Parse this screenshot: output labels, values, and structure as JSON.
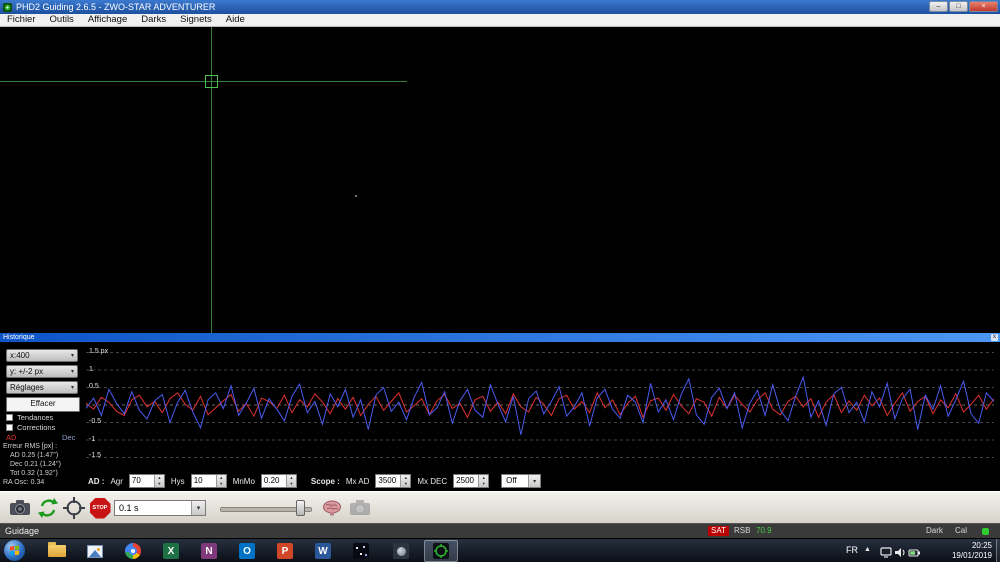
{
  "window": {
    "title": "PHD2 Guiding 2.6.5 - ZWO-STAR ADVENTURER"
  },
  "icons": {
    "minimize": "–",
    "maximize": "□",
    "close": "×",
    "close_small": "x",
    "dropdown": "▾",
    "spin_up": "▲",
    "spin_down": "▼",
    "tray_expand": "▲"
  },
  "menu": {
    "items": [
      "Fichier",
      "Outils",
      "Affichage",
      "Darks",
      "Signets",
      "Aide"
    ]
  },
  "history": {
    "title": "Historique",
    "controls": {
      "scale_x": "x:400",
      "scale_y": "y: +/-2 px",
      "settings": "Réglages",
      "clear": "Effacer",
      "trend_label": "Tendances",
      "corrections_label": "Corrections",
      "legend_ra": "AD",
      "legend_dec": "Dec"
    },
    "stats": {
      "header": "Erreur RMS [px] :",
      "ra": "AD 0.25 (1.47'')",
      "dec": "Dec 0.21 (1.24'')",
      "tot": "Tot 0.32 (1.92'')",
      "osc": "RA Osc: 0.34"
    },
    "params": {
      "ra_label": "AD :",
      "agr_label": "Agr",
      "agr_value": "70",
      "hys_label": "Hys",
      "hys_value": "10",
      "mnmo_label": "MnMo",
      "mnmo_value": "0.20",
      "scope_label": "Scope :",
      "mxad_label": "Mx AD",
      "mxad_value": "3500",
      "mxdec_label": "Mx DEC",
      "mxdec_value": "2500",
      "dec_mode_value": "Off"
    }
  },
  "chart_data": {
    "type": "line",
    "title": "",
    "xlabel": "",
    "ylabel": "px",
    "ylim": [
      -1.5,
      1.5
    ],
    "grid": true,
    "ytick_values": [
      1.5,
      1,
      0.5,
      0,
      -0.5,
      -1,
      -1.5
    ],
    "ytick_labels": [
      "1.5 px",
      "1",
      "0.5",
      "-0.5",
      "-1",
      "-1.5"
    ],
    "legend_position": "left-panel",
    "series": [
      {
        "name": "AD",
        "color": "#e03232",
        "values": [
          0.05,
          -0.12,
          0.22,
          0.08,
          -0.18,
          -0.3,
          0.15,
          0.28,
          -0.05,
          0.1,
          -0.22,
          0.18,
          0.35,
          0.02,
          -0.15,
          0.25,
          -0.28,
          -0.08,
          0.12,
          0.3,
          -0.18,
          0.05,
          -0.32,
          0.2,
          0.1,
          -0.1,
          0.28,
          -0.22,
          0.15,
          -0.05,
          0.32,
          0.08,
          -0.25,
          0.18,
          -0.12,
          0.22,
          -0.3,
          0.02,
          0.25,
          -0.15,
          0.1,
          0.35,
          -0.2,
          -0.02,
          0.18,
          -0.28,
          0.12,
          0.3,
          -0.1,
          0.05,
          -0.35,
          0.15,
          0.25,
          -0.18,
          0.08,
          -0.25,
          0.32,
          -0.05,
          -0.2,
          0.22,
          0.02,
          -0.3,
          0.18,
          0.28,
          -0.12,
          0.1,
          -0.22,
          0.35,
          -0.08,
          0.15,
          -0.28,
          0.05,
          0.25,
          -0.35,
          0.12,
          0.2,
          -0.15,
          0.3,
          -0.02,
          -0.25,
          0.18,
          0.08,
          -0.32,
          0.22,
          -0.1,
          0.28,
          0.02,
          -0.2,
          0.15,
          0.35,
          -0.12,
          -0.28,
          0.1,
          0.25,
          -0.05,
          0.18,
          -0.35,
          0.08,
          0.3,
          -0.22,
          0.12,
          -0.15,
          0.28,
          -0.02,
          0.2,
          -0.3,
          0.05,
          0.35,
          -0.18,
          0.1,
          0.25,
          -0.25,
          0.15,
          -0.08,
          0.32,
          -0.2,
          0.02,
          0.28,
          -0.12,
          0.18
        ]
      },
      {
        "name": "Dec",
        "color": "#4b5bf0",
        "values": [
          -0.1,
          0.2,
          -0.3,
          0.45,
          0.05,
          -0.25,
          0.38,
          -0.15,
          -0.4,
          0.12,
          0.3,
          -0.5,
          0.08,
          0.42,
          -0.2,
          -0.65,
          0.15,
          0.35,
          -0.1,
          0.55,
          -0.3,
          0.05,
          0.48,
          -0.38,
          0.18,
          -0.12,
          -0.45,
          0.25,
          0.6,
          -0.22,
          0.1,
          -0.55,
          0.32,
          -0.05,
          0.45,
          -0.35,
          0.15,
          -0.7,
          0.28,
          0.5,
          -0.18,
          0.08,
          -0.42,
          0.22,
          0.65,
          -0.28,
          -0.08,
          0.38,
          -0.52,
          0.12,
          0.45,
          -0.15,
          -0.35,
          0.58,
          0.02,
          -0.48,
          0.25,
          -0.85,
          0.18,
          0.4,
          -0.25,
          0.1,
          0.52,
          -0.32,
          -0.05,
          0.35,
          -0.6,
          0.2,
          0.45,
          -0.12,
          -0.38,
          0.28,
          0.08,
          -0.5,
          0.62,
          -0.2,
          0.15,
          -0.42,
          0.3,
          0.75,
          -0.28,
          -0.55,
          0.22,
          0.48,
          -0.1,
          0.35,
          -0.65,
          0.05,
          0.42,
          -0.3,
          0.58,
          -0.15,
          -0.45,
          0.25,
          0.8,
          -0.35,
          0.12,
          -0.58,
          0.32,
          0.5,
          -0.22,
          0.08,
          -0.48,
          0.38,
          -0.05,
          0.62,
          -0.4,
          0.18,
          0.45,
          -0.7,
          0.28,
          -0.12,
          0.55,
          -0.32,
          0.15,
          0.68,
          -0.25,
          -0.52,
          0.35,
          0.1
        ]
      }
    ]
  },
  "toolbar": {
    "exposure_value": "0.1 s",
    "stop_label": "STOP"
  },
  "statusbar": {
    "state": "Guidage",
    "sat_label": "SAT",
    "rsb_label": "RSB",
    "rsb_value": "70.9",
    "dark_label": "Dark",
    "cal_label": "Cal"
  },
  "taskbar": {
    "apps": [
      {
        "name": "explorer"
      },
      {
        "name": "photo-viewer"
      },
      {
        "name": "chrome"
      },
      {
        "name": "excel",
        "letter": "X"
      },
      {
        "name": "onenote",
        "letter": "N"
      },
      {
        "name": "outlook",
        "letter": "O"
      },
      {
        "name": "powerpoint",
        "letter": "P"
      },
      {
        "name": "word",
        "letter": "W"
      },
      {
        "name": "stellarium"
      },
      {
        "name": "astronomy-app"
      },
      {
        "name": "phd2",
        "active": true
      }
    ],
    "tray": {
      "lang": "FR",
      "time": "20:25",
      "date": "19/01/2019"
    }
  },
  "colors": {
    "ra_trace": "#e03232",
    "dec_trace": "#4b5bf0",
    "crosshair": "#3e963e",
    "sat_bg": "#bb0000",
    "rsb_value": "#44cc44",
    "status_led": "#2ecc2e"
  }
}
